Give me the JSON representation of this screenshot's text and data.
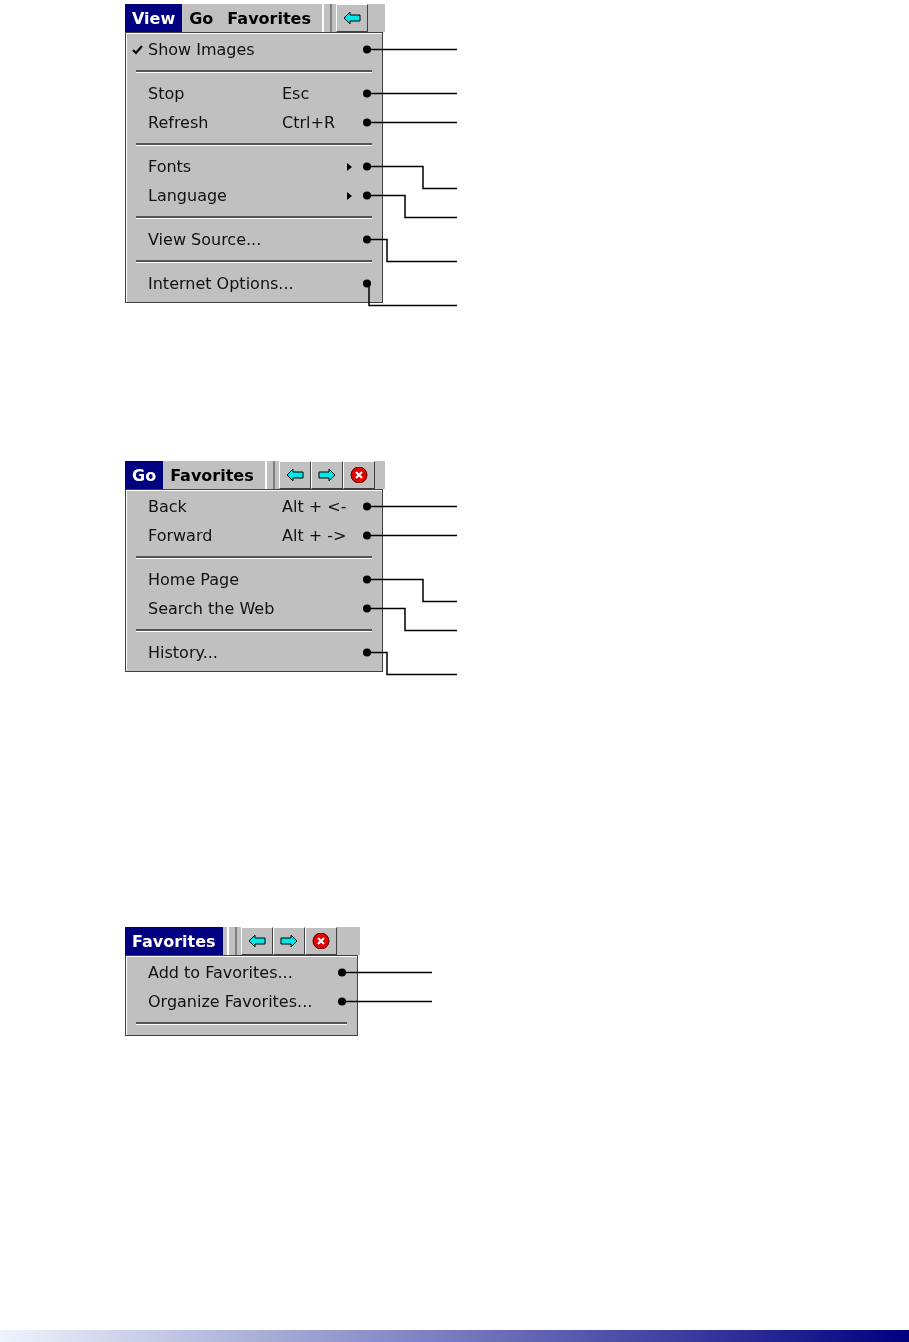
{
  "figures": [
    {
      "menu_bar": [
        {
          "label": "View",
          "selected": true
        },
        {
          "label": "Go",
          "selected": false
        },
        {
          "label": "Favorites",
          "selected": false
        }
      ],
      "menu": [
        {
          "kind": "item",
          "label": "Show Images",
          "checked": true,
          "submenu": false,
          "elbow": false
        },
        {
          "kind": "separator"
        },
        {
          "kind": "item",
          "label": "Stop",
          "shortcut": "Esc",
          "checked": false,
          "submenu": false,
          "elbow": false
        },
        {
          "kind": "item",
          "label": "Refresh",
          "shortcut": "Ctrl+R",
          "checked": false,
          "submenu": false,
          "elbow": false
        },
        {
          "kind": "separator"
        },
        {
          "kind": "item",
          "label": "Fonts",
          "checked": false,
          "submenu": true,
          "elbow": true
        },
        {
          "kind": "item",
          "label": "Language",
          "checked": false,
          "submenu": true,
          "elbow": true
        },
        {
          "kind": "separator"
        },
        {
          "kind": "item",
          "label": "View Source...",
          "checked": false,
          "submenu": false,
          "elbow": true
        },
        {
          "kind": "separator"
        },
        {
          "kind": "item",
          "label": "Internet Options...",
          "checked": false,
          "submenu": false,
          "elbow": true
        }
      ]
    },
    {
      "menu_bar": [
        {
          "label": "Go",
          "selected": true
        },
        {
          "label": "Favorites",
          "selected": false
        }
      ],
      "menu": [
        {
          "kind": "item",
          "label": "Back",
          "shortcut": "Alt + <-",
          "elbow": false
        },
        {
          "kind": "item",
          "label": "Forward",
          "shortcut": "Alt + ->",
          "elbow": false
        },
        {
          "kind": "separator"
        },
        {
          "kind": "item",
          "label": "Home Page",
          "elbow": true
        },
        {
          "kind": "item",
          "label": "Search the Web",
          "elbow": true
        },
        {
          "kind": "separator"
        },
        {
          "kind": "item",
          "label": "History...",
          "elbow": true
        }
      ]
    },
    {
      "menu_bar": [
        {
          "label": "Favorites",
          "selected": true
        }
      ],
      "menu": [
        {
          "kind": "item",
          "label": "Add to Favorites...",
          "elbow": false
        },
        {
          "kind": "item",
          "label": "Organize Favorites...",
          "elbow": false
        },
        {
          "kind": "separator"
        }
      ]
    }
  ]
}
